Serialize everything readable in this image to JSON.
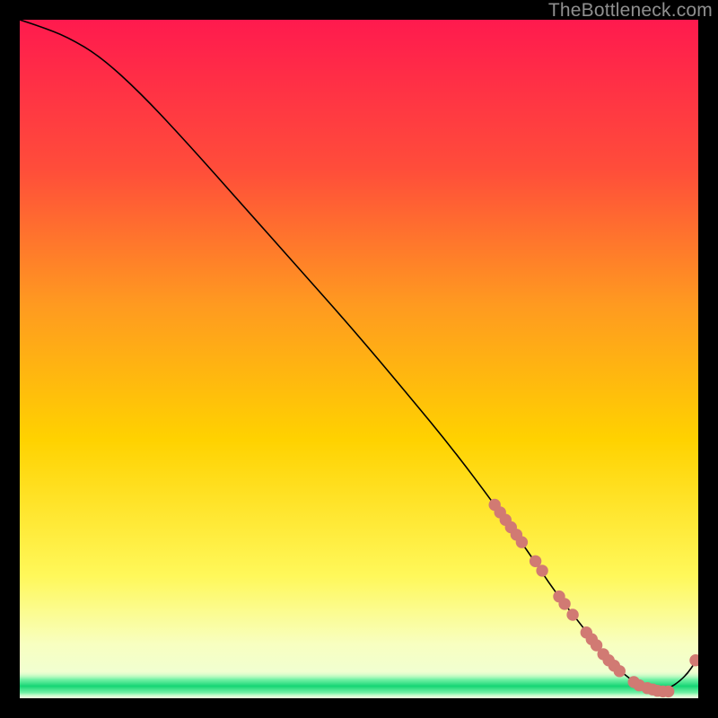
{
  "watermark": "TheBottleneck.com",
  "colors": {
    "grad_top": "#ff1a4e",
    "grad_upper_mid": "#ff7e2a",
    "grad_mid": "#ffd200",
    "grad_lower_mid": "#fff85a",
    "grad_floor": "#f4ffb0",
    "green_edge": "#32e98a",
    "green_core": "#0fd470",
    "curve": "#000000",
    "marker": "#d17a73",
    "frame": "#000000"
  },
  "chart_data": {
    "type": "line",
    "title": "",
    "xlabel": "",
    "ylabel": "",
    "xlim": [
      0,
      100
    ],
    "ylim": [
      0,
      100
    ],
    "series": [
      {
        "name": "bottleneck-curve",
        "x": [
          0,
          3,
          7,
          12,
          18,
          25,
          33,
          41,
          49,
          57,
          64,
          70,
          75,
          79,
          83,
          86,
          89,
          92,
          95,
          98,
          100
        ],
        "y": [
          100,
          99,
          97.5,
          94.5,
          89,
          81.5,
          72.5,
          63.5,
          54.5,
          45,
          36.5,
          28.5,
          21.5,
          15.5,
          10.5,
          6.5,
          3.5,
          1.5,
          1,
          3,
          6
        ]
      }
    ],
    "markers": {
      "name": "highlighted-points",
      "x": [
        70.0,
        70.8,
        71.6,
        72.4,
        73.2,
        74.0,
        76.0,
        77.0,
        79.5,
        80.3,
        81.5,
        83.5,
        84.3,
        85.0,
        86.0,
        86.8,
        87.6,
        88.4,
        90.5,
        91.3,
        92.5,
        93.3,
        94.0,
        94.8,
        95.6,
        99.6
      ],
      "y": [
        28.5,
        27.4,
        26.3,
        25.2,
        24.1,
        23.0,
        20.2,
        18.8,
        15.0,
        13.9,
        12.3,
        9.7,
        8.7,
        7.8,
        6.5,
        5.6,
        4.8,
        4.0,
        2.4,
        1.9,
        1.5,
        1.3,
        1.1,
        1.0,
        1.0,
        5.6
      ]
    }
  }
}
